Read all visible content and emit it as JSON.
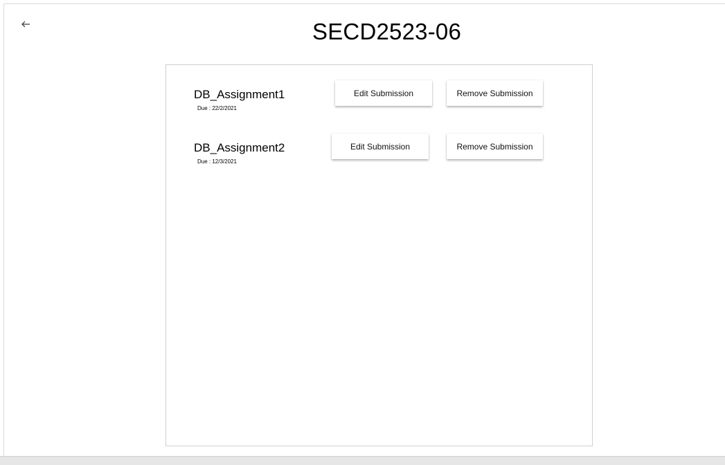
{
  "header": {
    "title": "SECD2523-06",
    "back_icon": "arrow-left-icon"
  },
  "assignments": [
    {
      "name": "DB_Assignment1",
      "due": "Due : 22/2/2021",
      "edit_label": "Edit Submission",
      "remove_label": "Remove Submission"
    },
    {
      "name": "DB_Assignment2",
      "due": "Due : 12/3/2021",
      "edit_label": "Edit Submission",
      "remove_label": "Remove Submission"
    }
  ]
}
